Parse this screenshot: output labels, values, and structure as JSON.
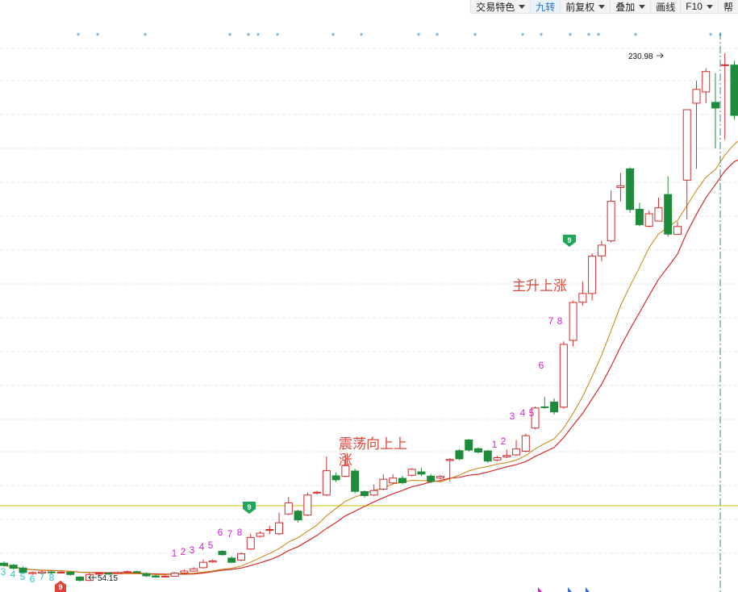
{
  "toolbar": {
    "items": [
      {
        "label": "交易特色",
        "dropdown": true
      },
      {
        "label": "九转",
        "dropdown": false,
        "active": true
      },
      {
        "label": "前复权",
        "dropdown": true
      },
      {
        "label": "叠加",
        "dropdown": true
      },
      {
        "label": "画线",
        "dropdown": false
      },
      {
        "label": "F10",
        "dropdown": true
      },
      {
        "label": "帮",
        "dropdown": false
      }
    ]
  },
  "colors": {
    "up": "#d42b2b",
    "down": "#1e8c3a",
    "ma_short": "#c8820a",
    "ma_long": "#d42b2b",
    "reference_line": "#c9c200",
    "marker": "#3a8fd8",
    "seq_up": "#d61fd6",
    "seq_down": "#1fc8c8",
    "annotation": "#e0483c"
  },
  "chart_data": {
    "type": "candlestick",
    "price_range": [
      38,
      236
    ],
    "high_label": "230.98",
    "low_label": "54.15",
    "annotations": [
      "震荡向上上涨",
      "主升上涨"
    ],
    "badges": [
      "9",
      "9",
      "9"
    ],
    "sequence_numbers_up": [
      "1",
      "2",
      "3",
      "4",
      "5",
      "6",
      "7",
      "8",
      "1",
      "2",
      "3",
      "4",
      "5",
      "6",
      "7",
      "8"
    ],
    "sequence_numbers_down": [
      "3",
      "4",
      "5",
      "6",
      "7",
      "8"
    ],
    "candles": [
      [
        48.2,
        47.4,
        48.8,
        46.9
      ],
      [
        47.5,
        46.4,
        47.9,
        46.0
      ],
      [
        46.5,
        44.9,
        47.0,
        44.5
      ],
      [
        44.5,
        44.9,
        45.3,
        44.1
      ],
      [
        44.7,
        45.1,
        45.6,
        44.2
      ],
      [
        45.1,
        44.8,
        45.5,
        44.4
      ],
      [
        44.9,
        45.0,
        45.4,
        44.6
      ],
      [
        45.0,
        44.2,
        45.3,
        43.8
      ],
      [
        43.3,
        42.1,
        43.6,
        41.8
      ],
      [
        42.1,
        44.2,
        44.8,
        41.9
      ],
      [
        44.3,
        44.6,
        45.0,
        44.0
      ],
      [
        44.6,
        44.5,
        45.0,
        44.1
      ],
      [
        44.5,
        44.9,
        45.3,
        44.2
      ],
      [
        45.0,
        45.2,
        45.6,
        44.6
      ],
      [
        45.2,
        45.0,
        45.6,
        44.8
      ],
      [
        44.5,
        43.7,
        45.0,
        43.3
      ],
      [
        43.7,
        43.3,
        44.1,
        43.0
      ],
      [
        43.4,
        43.6,
        44.0,
        43.2
      ],
      [
        43.6,
        44.7,
        45.0,
        43.4
      ],
      [
        44.7,
        45.4,
        46.0,
        44.5
      ],
      [
        45.4,
        46.2,
        46.8,
        45.2
      ],
      [
        46.6,
        48.5,
        49.5,
        46.3
      ],
      [
        48.6,
        49.0,
        49.6,
        48.3
      ],
      [
        52.4,
        51.2,
        52.8,
        50.9
      ],
      [
        50.0,
        48.5,
        50.6,
        48.2
      ],
      [
        49.3,
        51.5,
        52.1,
        49.0
      ],
      [
        53.2,
        57.3,
        58.6,
        52.8
      ],
      [
        57.7,
        58.8,
        59.4,
        57.2
      ],
      [
        60.1,
        60.1,
        61.4,
        58.4
      ],
      [
        58.6,
        62.5,
        66.1,
        58.2
      ],
      [
        65.6,
        69.5,
        71.6,
        65.2
      ],
      [
        66.6,
        63.5,
        67.1,
        62.6
      ],
      [
        65.2,
        72.3,
        73.2,
        64.8
      ],
      [
        73.0,
        73.3,
        73.8,
        72.5
      ],
      [
        72.3,
        80.9,
        85.9,
        71.9
      ],
      [
        79.1,
        77.7,
        80.3,
        76.9
      ],
      [
        78.9,
        82.7,
        86.4,
        78.6
      ],
      [
        80.8,
        73.6,
        81.6,
        72.9
      ],
      [
        73.5,
        72.1,
        74.0,
        71.4
      ],
      [
        72.3,
        73.9,
        76.0,
        71.9
      ],
      [
        74.4,
        77.9,
        79.6,
        74.0
      ],
      [
        76.6,
        78.3,
        79.6,
        76.1
      ],
      [
        78.2,
        76.7,
        79.1,
        76.1
      ],
      [
        79.3,
        81.4,
        81.8,
        78.9
      ],
      [
        80.5,
        79.7,
        82.0,
        79.0
      ],
      [
        79.0,
        77.1,
        79.8,
        76.5
      ],
      [
        78.3,
        78.9,
        79.4,
        77.8
      ],
      [
        84.5,
        84.9,
        85.3,
        77.2
      ],
      [
        88.0,
        85.1,
        88.6,
        84.6
      ],
      [
        91.8,
        88.2,
        92.1,
        87.6
      ],
      [
        88.7,
        87.5,
        89.1,
        87.0
      ],
      [
        87.9,
        84.3,
        88.3,
        83.7
      ],
      [
        84.7,
        85.5,
        86.1,
        84.3
      ],
      [
        85.8,
        86.3,
        88.4,
        85.4
      ],
      [
        86.5,
        88.6,
        91.7,
        86.1
      ],
      [
        87.8,
        93.3,
        94.0,
        87.4
      ],
      [
        96.0,
        103.1,
        103.6,
        95.5
      ],
      [
        103.5,
        103.3,
        107.0,
        102.8
      ],
      [
        105.2,
        101.7,
        106.5,
        100.8
      ],
      [
        103.4,
        125.6,
        126.6,
        102.8
      ],
      [
        127.0,
        140.4,
        141.1,
        124.9
      ],
      [
        140.5,
        143.6,
        147.9,
        139.3
      ],
      [
        143.6,
        156.8,
        157.8,
        141.1
      ],
      [
        156.9,
        160.7,
        162.2,
        154.9
      ],
      [
        162.2,
        176.2,
        180.0,
        161.7
      ],
      [
        181.1,
        181.7,
        186.2,
        176.2
      ],
      [
        187.7,
        173.3,
        188.2,
        172.1
      ],
      [
        173.4,
        167.9,
        175.7,
        167.4
      ],
      [
        167.4,
        171.8,
        172.9,
        167.0
      ],
      [
        169.2,
        173.9,
        177.5,
        169.2
      ],
      [
        178.6,
        164.6,
        185.0,
        163.7
      ],
      [
        164.5,
        167.3,
        168.9,
        164.4
      ],
      [
        183.7,
        208.6,
        208.6,
        169.8
      ],
      [
        210.9,
        215.8,
        218.8,
        187.7
      ],
      [
        214.9,
        222.1,
        223.2,
        210.9
      ],
      [
        211.2,
        209.2,
        221.6,
        194.9
      ],
      [
        224.5,
        224.5,
        228.6,
        197.9
      ],
      [
        224.4,
        206.6,
        225.9,
        205.1
      ],
      [
        201.7,
        197.4,
        213.3,
        192.8
      ],
      [
        203.3,
        188.9,
        206.7,
        181.7
      ],
      [
        197.5,
        187.2,
        205.6,
        184.1
      ],
      [
        187.4,
        191.7,
        195.9,
        185.6
      ]
    ]
  }
}
